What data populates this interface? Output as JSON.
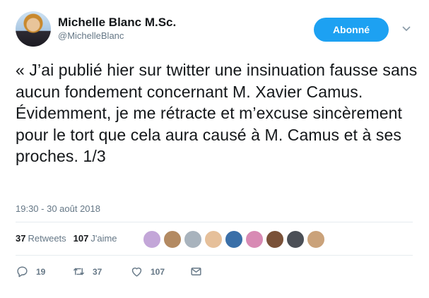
{
  "user": {
    "name": "Michelle Blanc M.Sc.",
    "handle": "@MichelleBlanc"
  },
  "follow_button": {
    "label": "Abonné",
    "color": "#1da1f2"
  },
  "tweet": {
    "text": "« J’ai publié hier sur twitter une insinuation fausse sans aucun fondement concernant M. Xavier Camus. Évidemment, je me rétracte et m’excuse sincèrement pour le tort que cela aura causé à M. Camus et à ses proches. 1/3",
    "timestamp": "19:30 - 30 août 2018"
  },
  "stats": {
    "retweets_count": "37",
    "retweets_label": "Retweets",
    "likes_count": "107",
    "likes_label": "J'aime"
  },
  "likers": [
    {
      "color": "#c3a6d8"
    },
    {
      "color": "#b38a62"
    },
    {
      "color": "#a8b3bd"
    },
    {
      "color": "#e6c09a"
    },
    {
      "color": "#3a6fa8"
    },
    {
      "color": "#d88ab4"
    },
    {
      "color": "#7a5138"
    },
    {
      "color": "#4b4f56"
    },
    {
      "color": "#caa27a"
    }
  ],
  "actions": {
    "reply_count": "19",
    "retweet_count": "37",
    "like_count": "107",
    "icons": [
      "reply-icon",
      "retweet-icon",
      "like-icon",
      "direct-message-icon"
    ]
  }
}
